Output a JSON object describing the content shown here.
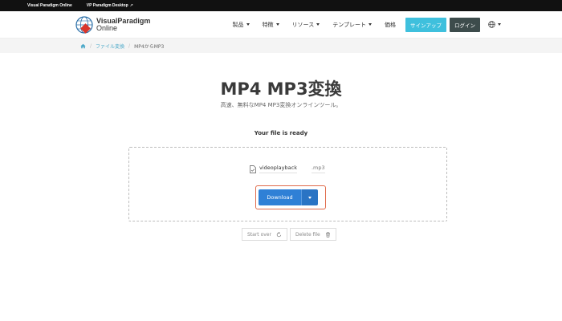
{
  "topbar": {
    "brand": "Visual Paradigm Online",
    "desktop_link": "VP Paradigm Desktop"
  },
  "logo": {
    "line1": "VisualParadigm",
    "line2": "Online"
  },
  "nav": {
    "products": "製品",
    "features": "特徴",
    "resources": "リソース",
    "templates": "テンプレート",
    "pricing": "価格",
    "signup": "サインアップ",
    "login": "ログイン"
  },
  "breadcrumb": {
    "file_convert": "ファイル変換",
    "current": "MP4からMP3"
  },
  "page": {
    "title": "MP4 MP3変換",
    "subtitle": "高速、無料なMP4 MP3変換オンラインツール。",
    "ready": "Your file is ready"
  },
  "file": {
    "name": "videoplayback",
    "ext": ".mp3"
  },
  "actions": {
    "download": "Download",
    "start_over": "Start over",
    "delete_file": "Delete file"
  },
  "colors": {
    "signup": "#3fc0dd",
    "login": "#3d4c4c",
    "download": "#2f80d6",
    "highlight": "#e06a4a"
  }
}
